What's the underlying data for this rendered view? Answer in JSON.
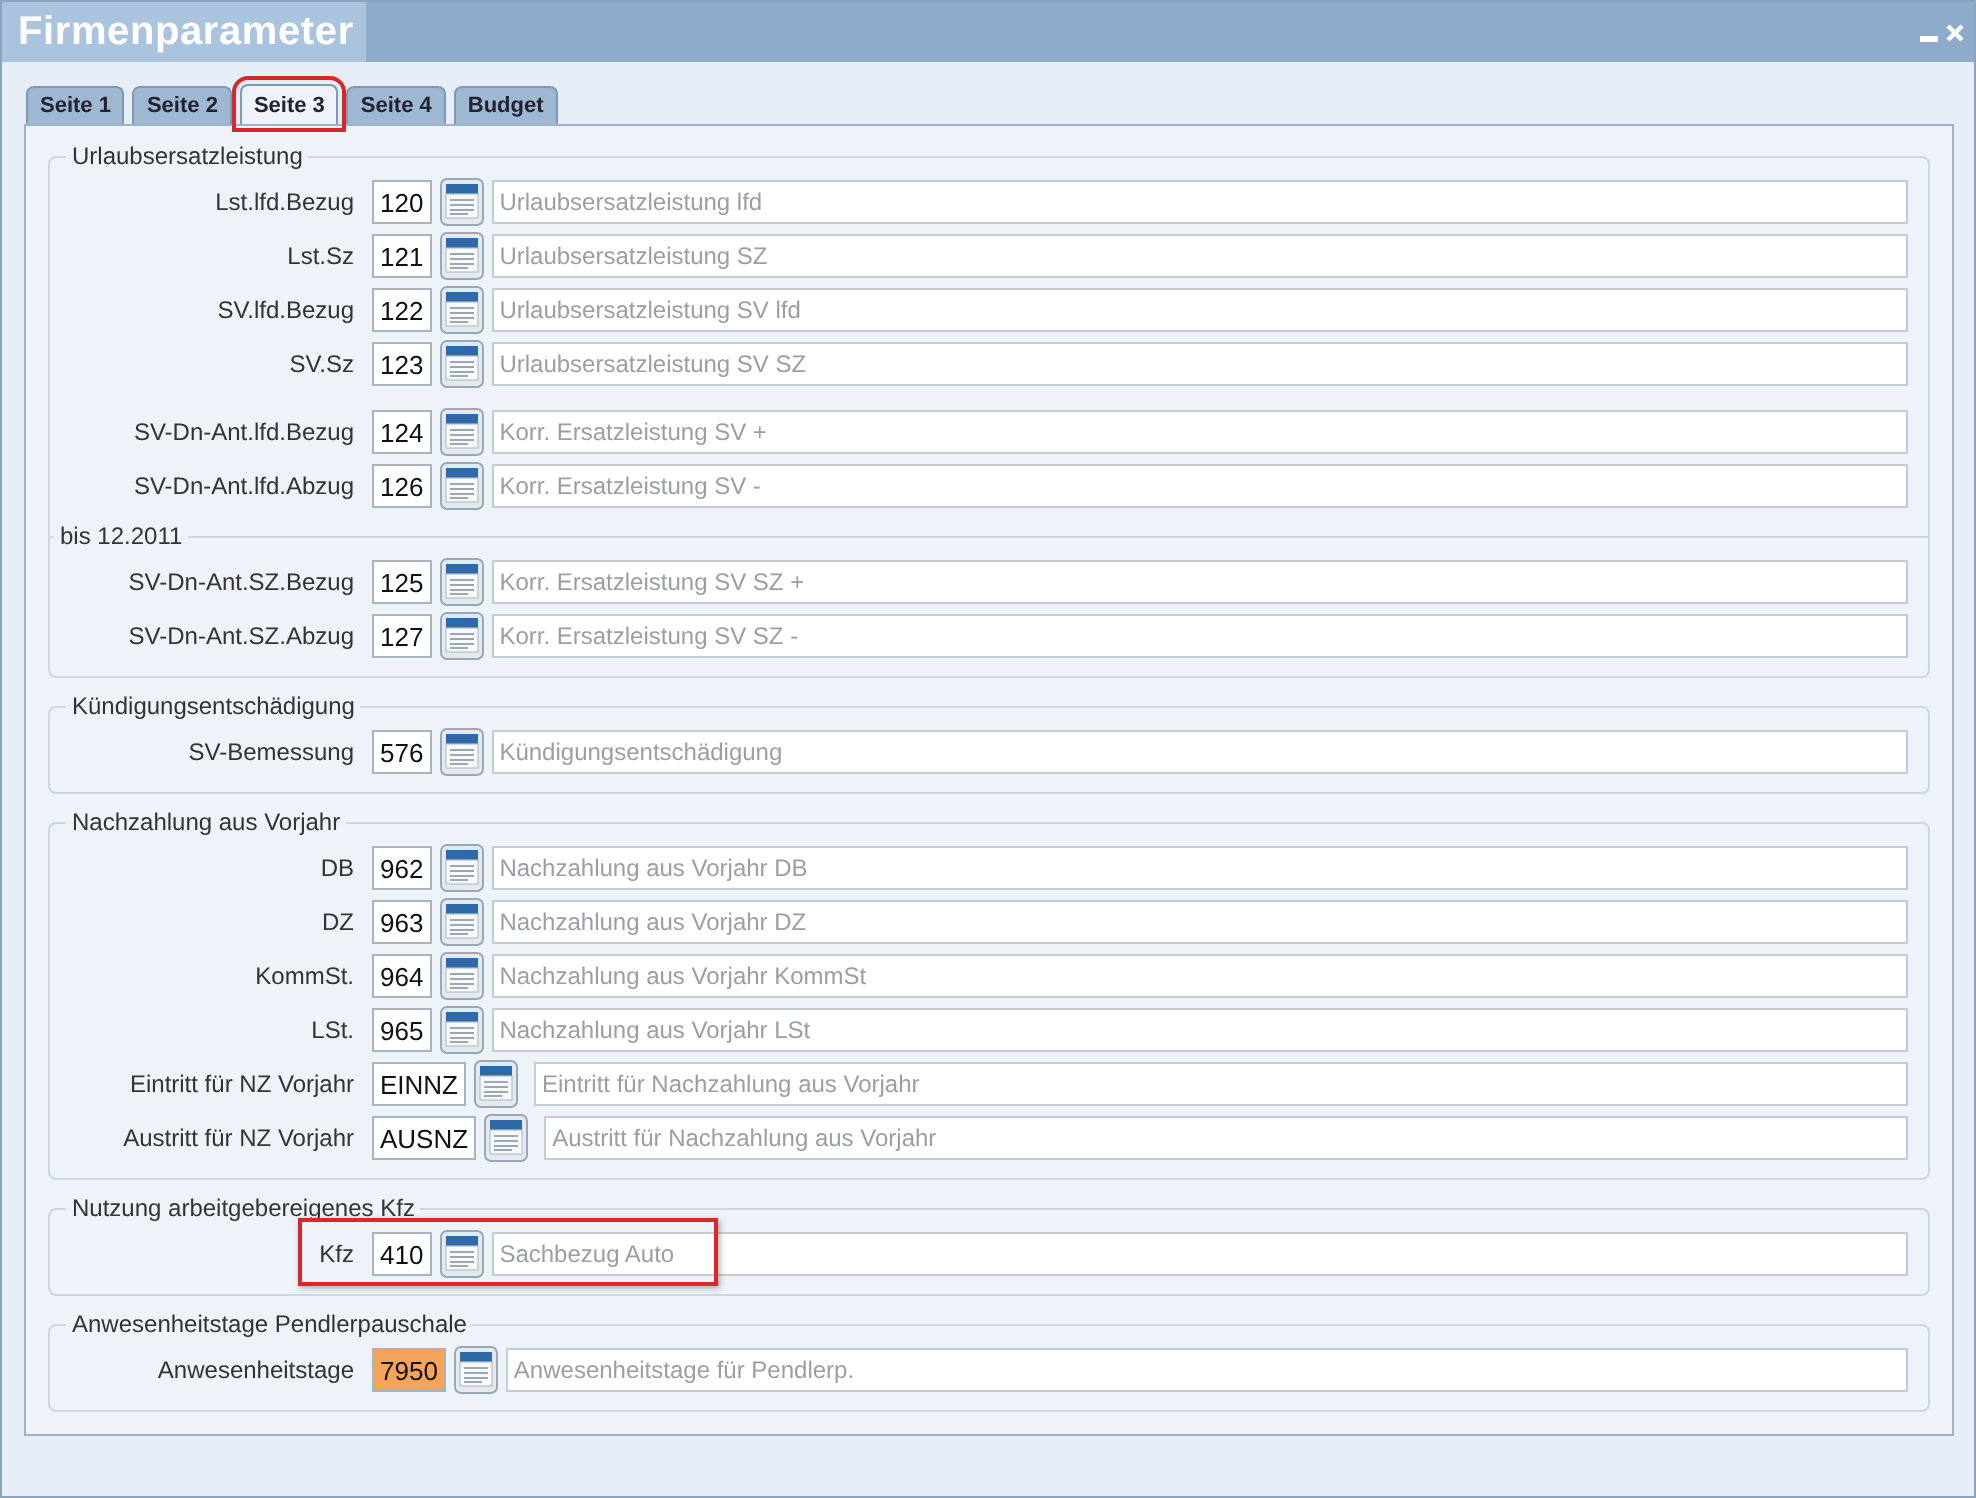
{
  "window": {
    "title": "Firmenparameter"
  },
  "tabs": [
    {
      "label": "Seite 1",
      "selected": false,
      "highlighted": false
    },
    {
      "label": "Seite 2",
      "selected": false,
      "highlighted": false
    },
    {
      "label": "Seite 3",
      "selected": true,
      "highlighted": true
    },
    {
      "label": "Seite 4",
      "selected": false,
      "highlighted": false
    },
    {
      "label": "Budget",
      "selected": false,
      "highlighted": false
    }
  ],
  "groups": [
    {
      "title": "Urlaubsersatzleistung",
      "blocks": [
        [
          {
            "label": "Lst.lfd.Bezug",
            "value": "120",
            "description": "Urlaubsersatzleistung lfd",
            "kind": "number",
            "highlighted": false,
            "marked": false
          },
          {
            "label": "Lst.Sz",
            "value": "121",
            "description": "Urlaubsersatzleistung SZ",
            "kind": "number",
            "highlighted": false,
            "marked": false
          },
          {
            "label": "SV.lfd.Bezug",
            "value": "122",
            "description": "Urlaubsersatzleistung SV lfd",
            "kind": "number",
            "highlighted": false,
            "marked": false
          },
          {
            "label": "SV.Sz",
            "value": "123",
            "description": "Urlaubsersatzleistung SV SZ",
            "kind": "number",
            "highlighted": false,
            "marked": false
          }
        ],
        [
          {
            "label": "SV-Dn-Ant.lfd.Bezug",
            "value": "124",
            "description": "Korr. Ersatzleistung SV +",
            "kind": "number",
            "highlighted": false,
            "marked": false
          },
          {
            "label": "SV-Dn-Ant.lfd.Abzug",
            "value": "126",
            "description": "Korr. Ersatzleistung SV -",
            "kind": "number",
            "highlighted": false,
            "marked": false
          }
        ]
      ],
      "subgroup": {
        "title": "bis 12.2011",
        "rows": [
          {
            "label": "SV-Dn-Ant.SZ.Bezug",
            "value": "125",
            "description": "Korr. Ersatzleistung SV SZ +",
            "kind": "number",
            "highlighted": false,
            "marked": false
          },
          {
            "label": "SV-Dn-Ant.SZ.Abzug",
            "value": "127",
            "description": "Korr. Ersatzleistung SV SZ -",
            "kind": "number",
            "highlighted": false,
            "marked": false
          }
        ]
      }
    },
    {
      "title": "Kündigungsentschädigung",
      "blocks": [
        [
          {
            "label": "SV-Bemessung",
            "value": "576",
            "description": "Kündigungsentschädigung",
            "kind": "number",
            "highlighted": false,
            "marked": false
          }
        ]
      ]
    },
    {
      "title": "Nachzahlung aus Vorjahr",
      "blocks": [
        [
          {
            "label": "DB",
            "value": "962",
            "description": "Nachzahlung aus Vorjahr DB",
            "kind": "number",
            "highlighted": false,
            "marked": false
          },
          {
            "label": "DZ",
            "value": "963",
            "description": "Nachzahlung aus Vorjahr DZ",
            "kind": "number",
            "highlighted": false,
            "marked": false
          },
          {
            "label": "KommSt.",
            "value": "964",
            "description": "Nachzahlung aus Vorjahr KommSt",
            "kind": "number",
            "highlighted": false,
            "marked": false
          },
          {
            "label": "LSt.",
            "value": "965",
            "description": "Nachzahlung aus Vorjahr LSt",
            "kind": "number",
            "highlighted": false,
            "marked": false
          },
          {
            "label": "Eintritt für NZ Vorjahr",
            "value": "EINNZ",
            "description": "Eintritt für Nachzahlung aus Vorjahr",
            "kind": "code",
            "highlighted": false,
            "marked": false
          },
          {
            "label": "Austritt für NZ Vorjahr",
            "value": "AUSNZ",
            "description": "Austritt für Nachzahlung aus Vorjahr",
            "kind": "code",
            "highlighted": false,
            "marked": false
          }
        ]
      ]
    },
    {
      "title": "Nutzung arbeitgebereigenes Kfz",
      "blocks": [
        [
          {
            "label": "Kfz",
            "value": "410",
            "description": "Sachbezug Auto",
            "kind": "number",
            "highlighted": true,
            "marked": false
          }
        ]
      ]
    },
    {
      "title": "Anwesenheitstage Pendlerpauschale",
      "blocks": [
        [
          {
            "label": "Anwesenheitstage",
            "value": "7950",
            "description": "Anwesenheitstage für Pendlerp.",
            "kind": "number",
            "highlighted": false,
            "marked": true
          }
        ]
      ]
    }
  ]
}
